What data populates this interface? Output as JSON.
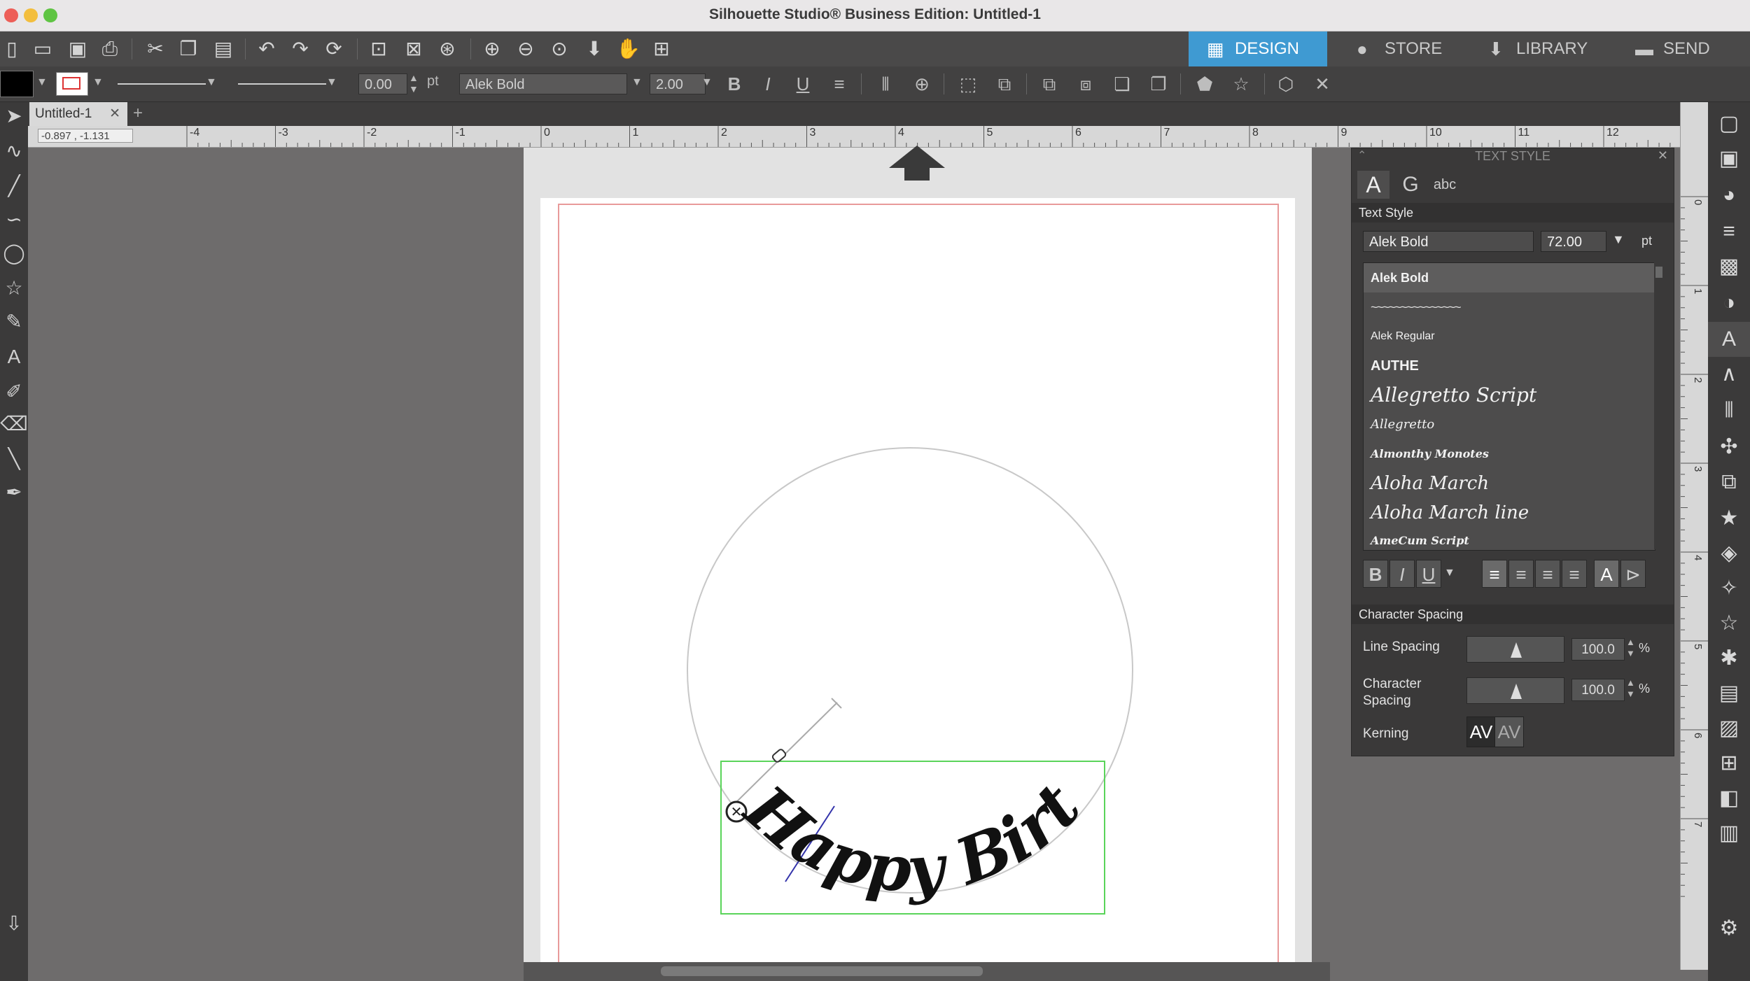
{
  "window": {
    "title": "Silhouette Studio® Business Edition: Untitled-1"
  },
  "nav_tabs": [
    {
      "label": "DESIGN",
      "icon": "grid-icon",
      "active": true
    },
    {
      "label": "STORE",
      "icon": "store-icon",
      "active": false
    },
    {
      "label": "LIBRARY",
      "icon": "library-icon",
      "active": false
    },
    {
      "label": "SEND",
      "icon": "send-icon",
      "active": false
    }
  ],
  "toolbar2": {
    "line_width": "0.00",
    "line_unit": "pt",
    "font": "Alek Bold",
    "font_size": "2.00"
  },
  "document_tab": "Untitled-1",
  "cursor_coords": "-0.897 , -1.131",
  "ruler_labels": [
    "-4",
    "-3",
    "-2",
    "-1",
    "0",
    "1",
    "2",
    "3",
    "4",
    "5",
    "6",
    "7",
    "8",
    "9",
    "10",
    "11",
    "12"
  ],
  "vruler_labels": [
    "0",
    "1",
    "2",
    "3",
    "4",
    "5",
    "6",
    "7"
  ],
  "canvas_text": "Happy Birthday",
  "text_style_panel": {
    "header": "TEXT STYLE",
    "section_title": "Text Style",
    "font_name": "Alek Bold",
    "font_size": "72.00",
    "size_unit": "pt",
    "fonts": [
      "Alek Bold",
      "~~~~~~~~~~~~~~~",
      "Alek Regular",
      "AUTHE",
      "Allegretto Script",
      "Allegretto",
      "Almonthy Monotes",
      "Aloha March",
      "Aloha March line",
      "AmeCum Script"
    ],
    "char_spacing_title": "Character Spacing",
    "line_spacing_label": "Line Spacing",
    "line_spacing_value": "100.0",
    "char_spacing_label": "Character Spacing",
    "char_spacing_value": "100.0",
    "percent": "%",
    "kerning_label": "Kerning",
    "kerning_on": "AV",
    "kerning_off": "AV"
  }
}
